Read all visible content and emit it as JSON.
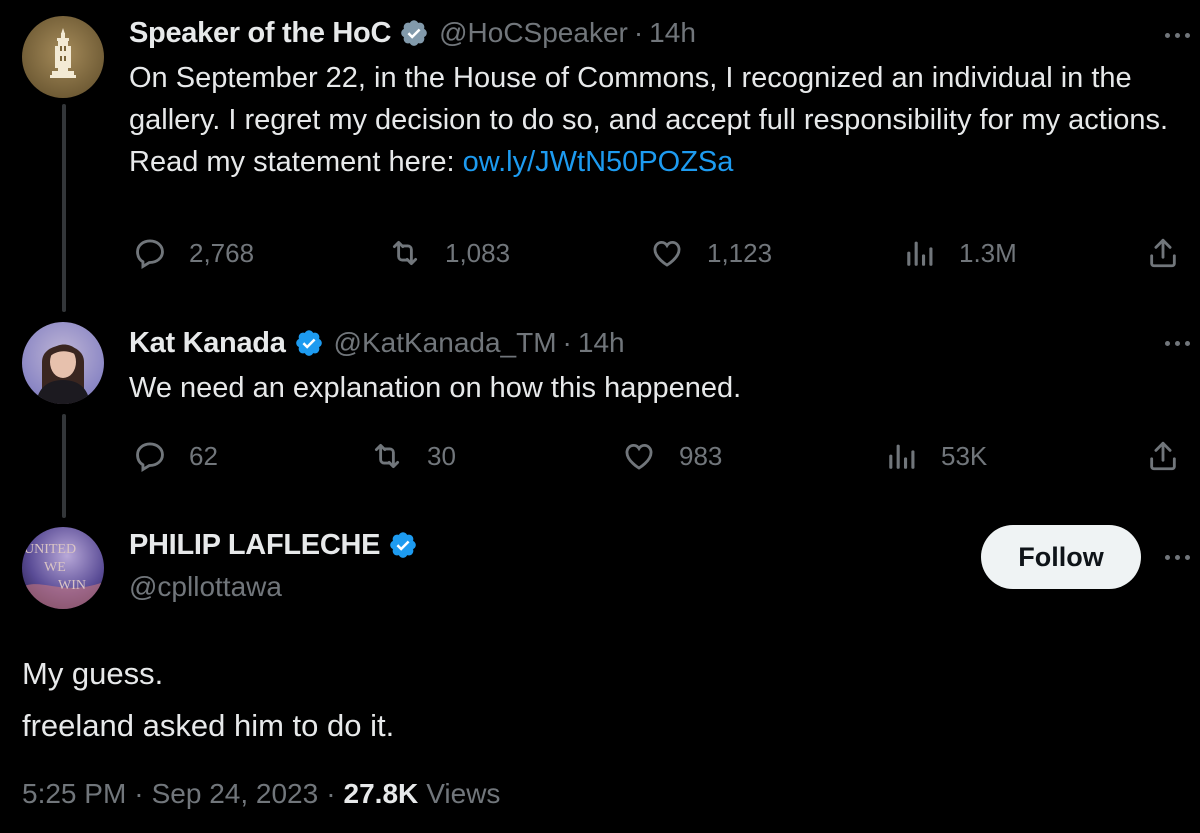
{
  "tweets": [
    {
      "name": "Speaker of the HoC",
      "handle": "@HoCSpeaker",
      "time": "14h",
      "text_before_link": "On September 22, in the House of Commons, I recognized an individual in the gallery. I regret my decision to do so, and accept full responsibility for my actions. Read my statement here: ",
      "link": "ow.ly/JWtN50POZSa",
      "replies": "2,768",
      "retweets": "1,083",
      "likes": "1,123",
      "views": "1.3M",
      "avatar_icon": "parliament-crest-icon",
      "verified_color": "#829aab"
    },
    {
      "name": "Kat Kanada",
      "handle": "@KatKanada_TM",
      "time": "14h",
      "text": "We need an explanation on how this happened.",
      "replies": "62",
      "retweets": "30",
      "likes": "983",
      "views": "53K",
      "avatar_icon": "profile-photo-icon",
      "verified_color": "#1d9bf0"
    }
  ],
  "main_tweet": {
    "name": "PHILIP LAFLECHE",
    "handle": "@cpllottawa",
    "follow_label": "Follow",
    "avatar_lines": [
      "UNITED",
      "WE",
      "WIN"
    ],
    "text_line1": "My guess.",
    "text_line2": "freeland asked him to do it.",
    "time": "5:25 PM",
    "date": "Sep 24, 2023",
    "views_count": "27.8K",
    "views_label": "Views",
    "verified_color": "#1d9bf0"
  },
  "colors": {
    "background": "#000000",
    "text": "#e7e9ea",
    "secondary": "#71767b",
    "link": "#1d9bf0"
  }
}
